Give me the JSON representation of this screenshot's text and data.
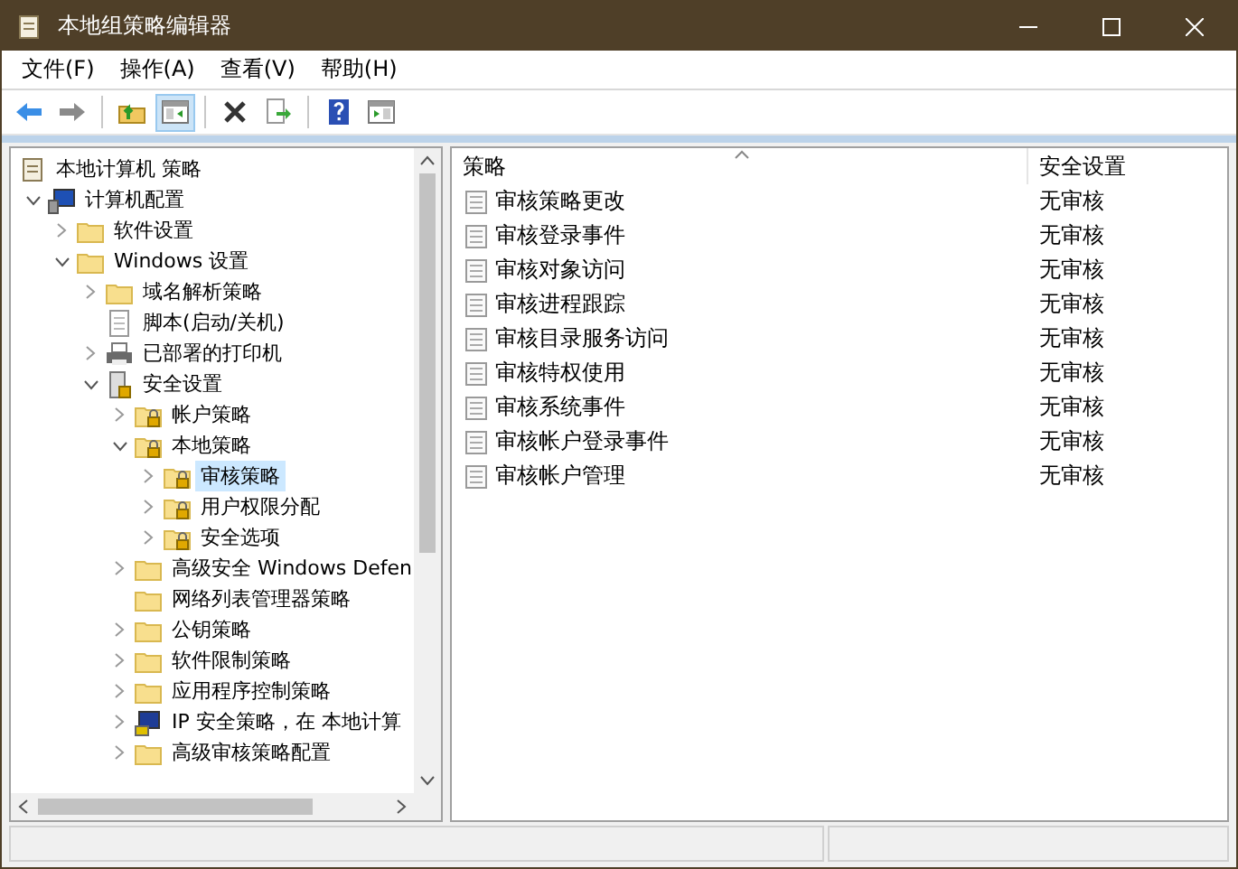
{
  "window": {
    "title": "本地组策略编辑器"
  },
  "menu": [
    "文件(F)",
    "操作(A)",
    "查看(V)",
    "帮助(H)"
  ],
  "toolbar": [
    {
      "kind": "back",
      "pressed": false
    },
    {
      "kind": "forward",
      "pressed": false
    },
    {
      "kind": "separator"
    },
    {
      "kind": "up",
      "pressed": false
    },
    {
      "kind": "tree",
      "pressed": true
    },
    {
      "kind": "separator"
    },
    {
      "kind": "delete",
      "pressed": false
    },
    {
      "kind": "export",
      "pressed": false
    },
    {
      "kind": "separator"
    },
    {
      "kind": "help",
      "pressed": false
    },
    {
      "kind": "pane",
      "pressed": false
    }
  ],
  "tree": {
    "label": "本地计算机 策略",
    "kind": "policy",
    "selected": false,
    "children": [
      {
        "label": "计算机配置",
        "kind": "computer",
        "expanded": true,
        "selected": false,
        "children": [
          {
            "label": "软件设置",
            "kind": "folder",
            "expanded": false,
            "selected": false
          },
          {
            "label": "Windows 设置",
            "kind": "folder",
            "expanded": true,
            "selected": false,
            "children": [
              {
                "label": "域名解析策略",
                "kind": "folder",
                "expanded": false,
                "selected": false
              },
              {
                "label": "脚本(启动/关机)",
                "kind": "script",
                "selected": false
              },
              {
                "label": "已部署的打印机",
                "kind": "printer",
                "expanded": false,
                "selected": false
              },
              {
                "label": "安全设置",
                "kind": "security",
                "expanded": true,
                "selected": false,
                "children": [
                  {
                    "label": "帐户策略",
                    "kind": "lockfolder",
                    "expanded": false,
                    "selected": false
                  },
                  {
                    "label": "本地策略",
                    "kind": "lockfolder",
                    "expanded": true,
                    "selected": false,
                    "children": [
                      {
                        "label": "审核策略",
                        "kind": "lockfolder",
                        "expanded": false,
                        "selected": true
                      },
                      {
                        "label": "用户权限分配",
                        "kind": "lockfolder",
                        "expanded": false,
                        "selected": false
                      },
                      {
                        "label": "安全选项",
                        "kind": "lockfolder",
                        "expanded": false,
                        "selected": false
                      }
                    ]
                  },
                  {
                    "label": "高级安全 Windows Defen",
                    "kind": "folder",
                    "expanded": false,
                    "selected": false
                  },
                  {
                    "label": "网络列表管理器策略",
                    "kind": "folder",
                    "selected": false
                  },
                  {
                    "label": "公钥策略",
                    "kind": "folder",
                    "expanded": false,
                    "selected": false
                  },
                  {
                    "label": "软件限制策略",
                    "kind": "folder",
                    "expanded": false,
                    "selected": false
                  },
                  {
                    "label": "应用程序控制策略",
                    "kind": "folder",
                    "expanded": false,
                    "selected": false
                  },
                  {
                    "label": "IP 安全策略，在 本地计算",
                    "kind": "ipsec",
                    "expanded": false,
                    "selected": false
                  },
                  {
                    "label": "高级审核策略配置",
                    "kind": "folder",
                    "expanded": false,
                    "selected": false
                  }
                ]
              }
            ]
          }
        ]
      }
    ]
  },
  "list": {
    "columns": [
      "策略",
      "安全设置"
    ],
    "rows": [
      {
        "policy": "审核策略更改",
        "setting": "无审核"
      },
      {
        "policy": "审核登录事件",
        "setting": "无审核"
      },
      {
        "policy": "审核对象访问",
        "setting": "无审核"
      },
      {
        "policy": "审核进程跟踪",
        "setting": "无审核"
      },
      {
        "policy": "审核目录服务访问",
        "setting": "无审核"
      },
      {
        "policy": "审核特权使用",
        "setting": "无审核"
      },
      {
        "policy": "审核系统事件",
        "setting": "无审核"
      },
      {
        "policy": "审核帐户登录事件",
        "setting": "无审核"
      },
      {
        "policy": "审核帐户管理",
        "setting": "无审核"
      }
    ]
  }
}
